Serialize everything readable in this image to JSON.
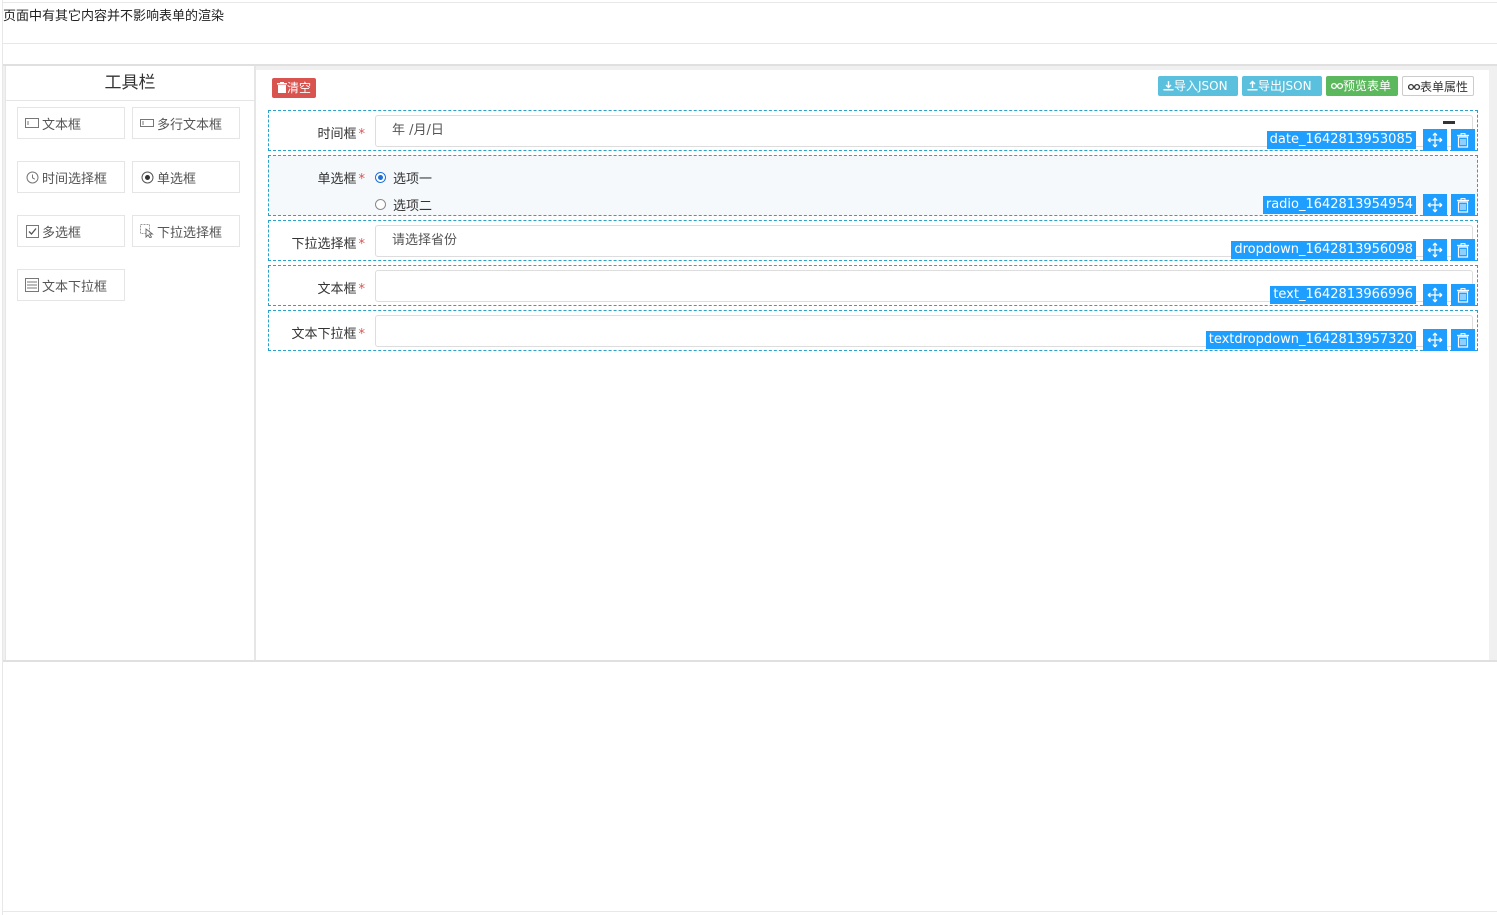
{
  "page": {
    "notice": "页面中有其它内容并不影响表单的渲染"
  },
  "toolbar": {
    "title": "工具栏",
    "items": [
      {
        "label": "文本框",
        "icon": "text-input-icon"
      },
      {
        "label": "多行文本框",
        "icon": "textarea-icon"
      },
      {
        "label": "时间选择框",
        "icon": "clock-icon"
      },
      {
        "label": "单选框",
        "icon": "radio-icon"
      },
      {
        "label": "多选框",
        "icon": "checkbox-icon"
      },
      {
        "label": "下拉选择框",
        "icon": "pointer-select-icon"
      },
      {
        "label": "文本下拉框",
        "icon": "list-dropdown-icon"
      }
    ]
  },
  "actions": {
    "clear": "清空",
    "import_json": "导入JSON",
    "export_json": "导出JSON",
    "preview": "预览表单",
    "form_props": "表单属性"
  },
  "form": {
    "fields": [
      {
        "label": "时间框",
        "type": "date",
        "value": "年 /月/日",
        "tag": "date_1642813953085"
      },
      {
        "label": "单选框",
        "type": "radio",
        "options": [
          "选项一",
          "选项二"
        ],
        "selected": "选项一",
        "tag": "radio_1642813954954"
      },
      {
        "label": "下拉选择框",
        "type": "dropdown",
        "value": "请选择省份",
        "tag": "dropdown_1642813956098"
      },
      {
        "label": "文本框",
        "type": "text",
        "value": "",
        "tag": "text_1642813966996"
      },
      {
        "label": "文本下拉框",
        "type": "textdropdown",
        "value": "",
        "tag": "textdropdown_1642813957320"
      }
    ],
    "required_mark": "*"
  },
  "colors": {
    "danger": "#d9534f",
    "info": "#5bc0de",
    "success": "#5cb85c",
    "tag": "#1e9fff",
    "dashed_border": "#2aa1c8"
  }
}
